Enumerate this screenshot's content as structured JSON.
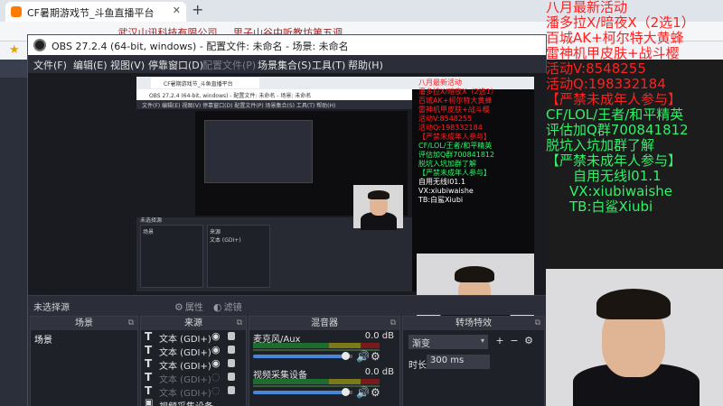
{
  "browser": {
    "tab_title": "CF暑期游戏节_斗鱼直播平台",
    "tab_close": "✕",
    "new_tab": "+",
    "url_text": "...武汉山讯科技有限公司 ... 思子山谷中听教坊第五调..."
  },
  "obs": {
    "title": "OBS 27.2.4 (64-bit, windows) - 配置文件: 未命名 - 场景: 未命名",
    "menu": [
      "文件(F)",
      "编辑(E)",
      "视图(V)",
      "停靠窗口(D)",
      "配置文件(P)",
      "场景集合(S)",
      "工具(T)",
      "帮助(H)"
    ],
    "status_text": "未选择源",
    "properties_btn": "属性",
    "filters_btn": "滤镜",
    "docks": {
      "scenes_title": "场景",
      "sources_title": "来源",
      "mixer_title": "混音器",
      "transitions_title": "转场特效"
    },
    "scenes": [
      "场景"
    ],
    "sources": [
      {
        "type": "T",
        "name": "文本 (GDI+)",
        "visible": true
      },
      {
        "type": "T",
        "name": "文本 (GDI+)",
        "visible": true
      },
      {
        "type": "T",
        "name": "文本 (GDI+)",
        "visible": true
      },
      {
        "type": "T",
        "name": "文本 (GDI+)",
        "visible": false
      },
      {
        "type": "T",
        "name": "文本 (GDI+)",
        "visible": false
      },
      {
        "type": "cam",
        "name": "视频采集设备",
        "visible": true
      }
    ],
    "mixer": [
      {
        "name": "麦克风/Aux",
        "db": "0.0 dB",
        "level": 0.88
      },
      {
        "name": "视频采集设备",
        "db": "0.0 dB",
        "level": 0.88
      }
    ],
    "transition": {
      "selected": "渐变",
      "duration_label": "时长",
      "duration_value": "300 ms"
    }
  },
  "nested": {
    "tab_title": "CF暑期游戏节_斗鱼直播平台",
    "title": "OBS 27.2.4 (64-bit, windows) - 配置文件: 未命名 - 场景: 未命名",
    "menu": "文件(F)  编辑(E)  视图(V)  停靠窗口(D)  配置文件(P)  场景集合(S)  工具(T)  帮助(H)",
    "status": "未选择源",
    "dock_scenes": "场景",
    "dock_sources": "来源",
    "source_line": "文本 (GDI+)",
    "text_lines_red": [
      "八月最新活动",
      "潘多拉X/暗夜X（2选1）",
      "百城AK+柯尔特大黄蜂",
      "雷神机甲皮肤+战斗樱",
      "活动V:8548255",
      "活动Q:198332184",
      "【严禁未成年人参与】"
    ],
    "text_lines_green": [
      "CF/LOL/王者/和平精英",
      "评估加Q群700841812",
      "脱坑入坑加群了解",
      "【严禁未成年人参与】"
    ],
    "text_lines_white": [
      "自用无线l01.1",
      "VX:xiubiwaishe",
      "TB:白鲨Xiubi"
    ]
  },
  "overlay": {
    "red_lines": [
      "八月最新活动",
      "潘多拉X/暗夜X（2选1）",
      "百城AK+柯尔特大黄蜂",
      "雷神机甲皮肤+战斗樱",
      "活动V:8548255",
      "活动Q:198332184",
      "【严禁未成年人参与】"
    ],
    "green_lines": [
      "CF/LOL/王者/和平精英",
      "评估加Q群700841812",
      "脱坑入坑加群了解",
      "【严禁未成年人参与】",
      "自用无线l01.1",
      "VX:xiubiwaishe",
      "TB:白鲨Xiubi"
    ]
  },
  "colors": {
    "overlay_red": "#ff2020",
    "overlay_green": "#33f06a",
    "obs_bg": "#2b2e38",
    "fader_blue": "#4a86d8"
  }
}
